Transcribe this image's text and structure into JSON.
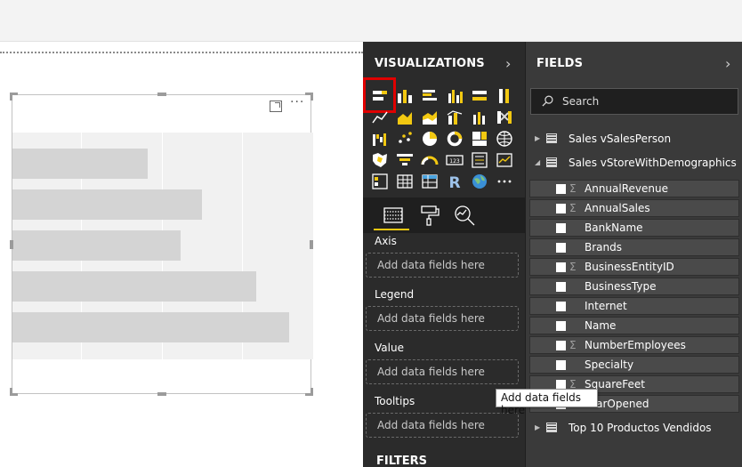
{
  "visualizations": {
    "title": "VISUALIZATIONS",
    "icons": [
      "stacked-bar-chart-icon",
      "stacked-column-chart-icon",
      "clustered-bar-chart-icon",
      "clustered-column-chart-icon",
      "100-stacked-bar-chart-icon",
      "100-stacked-column-chart-icon",
      "line-chart-icon",
      "area-chart-icon",
      "stacked-area-chart-icon",
      "line-and-stacked-column-icon",
      "line-and-clustered-column-icon",
      "ribbon-chart-icon",
      "waterfall-chart-icon",
      "scatter-chart-icon",
      "pie-chart-icon",
      "donut-chart-icon",
      "treemap-icon",
      "map-icon",
      "filled-map-icon",
      "funnel-icon",
      "gauge-icon",
      "card-icon",
      "multi-row-card-icon",
      "kpi-icon",
      "slicer-icon",
      "table-icon",
      "matrix-icon",
      "r-visual-icon",
      "globe-icon",
      "more-visuals-icon"
    ],
    "tabs": [
      "fields-tab-icon",
      "format-tab-icon",
      "analytics-tab-icon"
    ],
    "wells": [
      {
        "label": "Axis",
        "placeholder": "Add data fields here"
      },
      {
        "label": "Legend",
        "placeholder": "Add data fields here"
      },
      {
        "label": "Value",
        "placeholder": "Add data fields here"
      },
      {
        "label": "Tooltips",
        "placeholder": "Add data fields here"
      }
    ],
    "filters_label": "FILTERS"
  },
  "fields": {
    "title": "FIELDS",
    "search_placeholder": "Search",
    "tables": [
      {
        "name": "Sales vSalesPerson",
        "expanded": false
      },
      {
        "name": "Sales vStoreWithDemographics",
        "expanded": true
      },
      {
        "name": "Top 10 Productos Vendidos",
        "expanded": false
      }
    ],
    "field_list": [
      {
        "name": "AnnualRevenue",
        "sigma": "Σ"
      },
      {
        "name": "AnnualSales",
        "sigma": "Σ"
      },
      {
        "name": "BankName",
        "sigma": ""
      },
      {
        "name": "Brands",
        "sigma": ""
      },
      {
        "name": "BusinessEntityID",
        "sigma": "Σ"
      },
      {
        "name": "BusinessType",
        "sigma": ""
      },
      {
        "name": "Internet",
        "sigma": ""
      },
      {
        "name": "Name",
        "sigma": ""
      },
      {
        "name": "NumberEmployees",
        "sigma": "Σ"
      },
      {
        "name": "Specialty",
        "sigma": ""
      },
      {
        "name": "SquareFeet",
        "sigma": "Σ"
      },
      {
        "name": "YearOpened",
        "sigma": ""
      }
    ]
  },
  "tooltip": {
    "text": "Add data fields here"
  },
  "colors": {
    "accent": "#f2c811",
    "selection": "#e00000",
    "pane_dark": "#2b2b2b",
    "fields_bg": "#3a3a3a"
  },
  "chart_data": {
    "type": "bar",
    "placeholder": true,
    "values": [
      0.45,
      0.63,
      0.56,
      0.81,
      0.92
    ]
  }
}
